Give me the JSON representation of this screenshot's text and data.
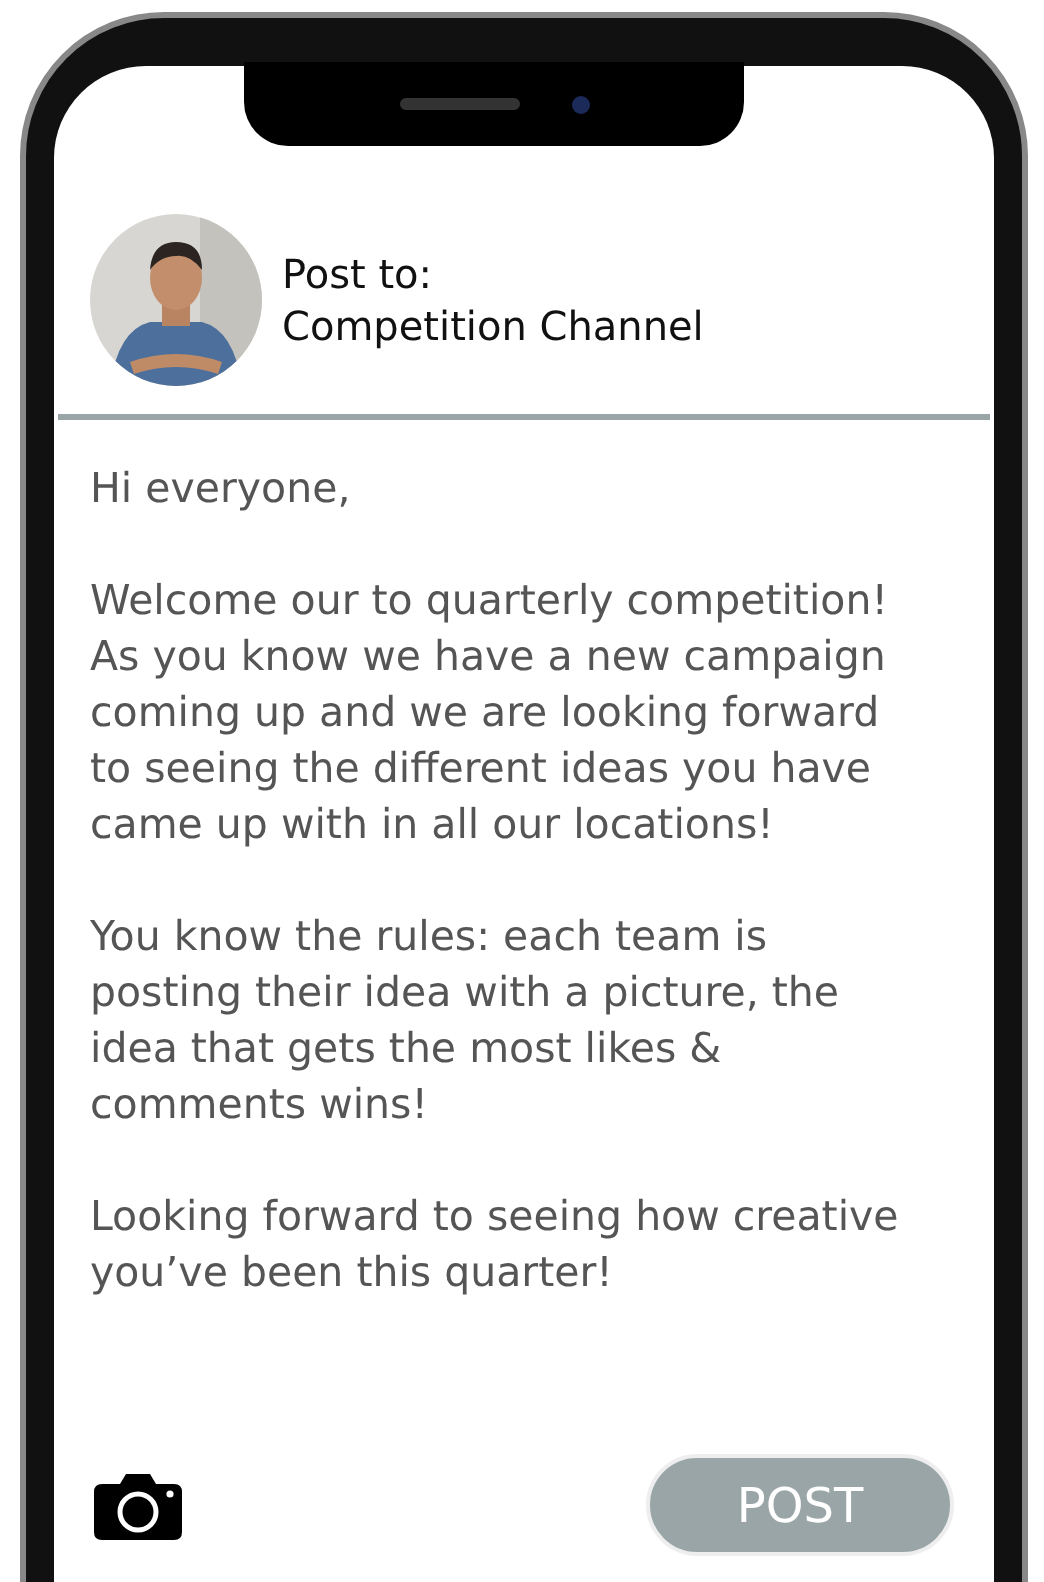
{
  "header": {
    "label": "Post to:",
    "channel": "Competition Channel"
  },
  "message": [
    "Hi everyone,",
    "Welcome our to quarterly competition! As you know we have a new campaign coming up and we are looking forward to seeing the different ideas you have came up with in all our locations!",
    "You know the rules: each team is posting their idea with a picture, the idea that gets the most likes & comments wins!",
    "Looking forward to seeing how creative you’ve been this quarter!"
  ],
  "post_button": {
    "label": "POST"
  }
}
